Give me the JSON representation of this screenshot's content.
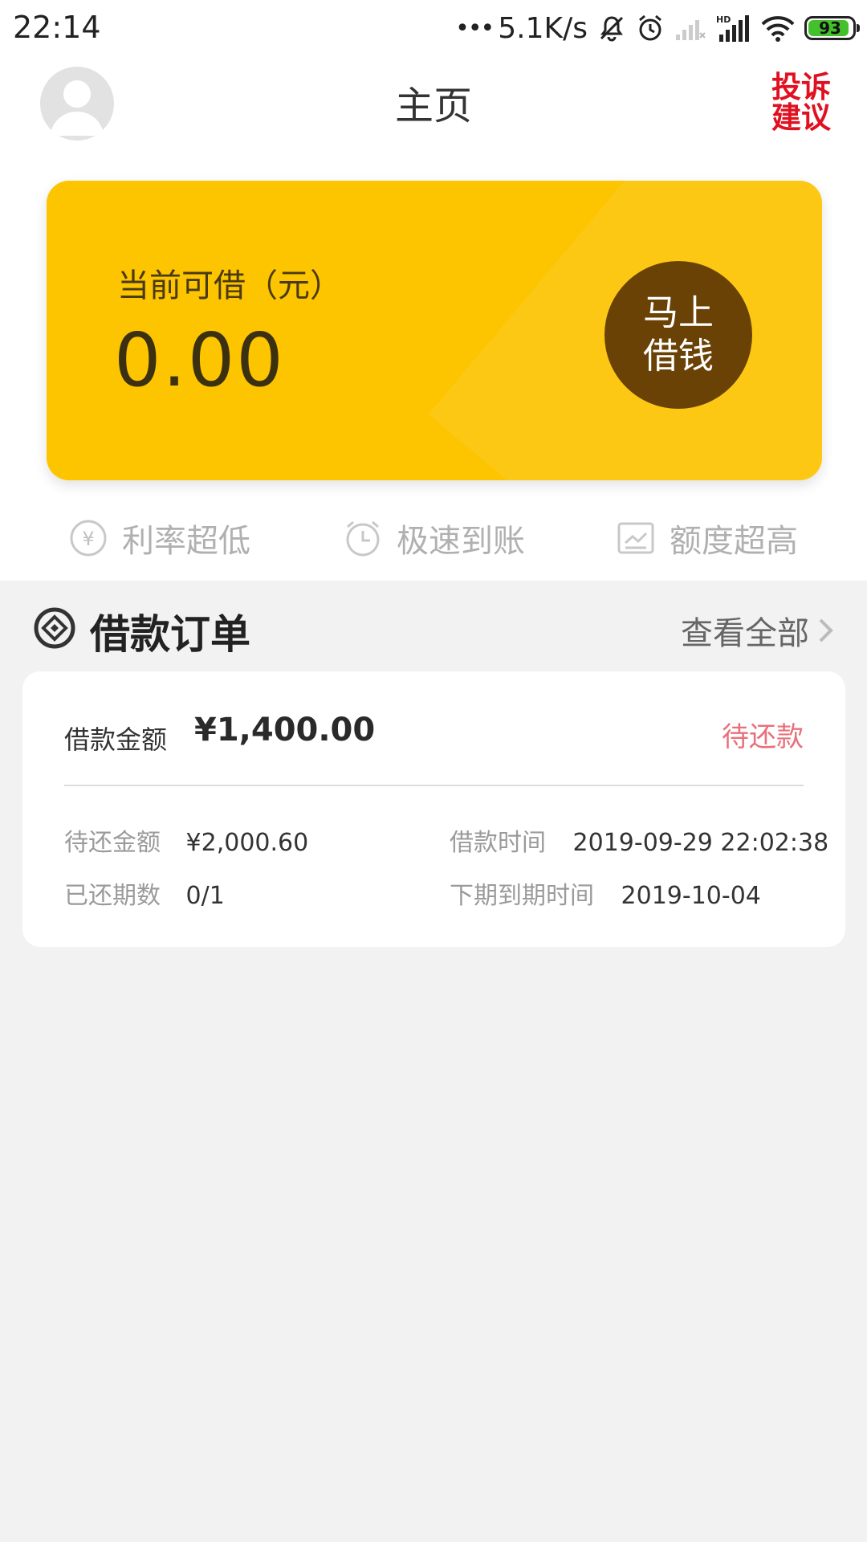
{
  "status_bar": {
    "time": "22:14",
    "dots": "•••",
    "net_speed": "5.1K/s",
    "hd": "HD",
    "battery_level": 93,
    "battery_label": "93",
    "battery_color": "#43c12c",
    "icons": [
      "mute-icon",
      "alarm-icon",
      "signal-icon",
      "signal-hd-icon",
      "wifi-icon",
      "battery-icon"
    ]
  },
  "header": {
    "title": "主页",
    "complaint_label": "投诉建议",
    "avatar_icon": "user-avatar-icon"
  },
  "credit_card": {
    "label": "当前可借（元）",
    "amount": "0.00",
    "button_label": "马上借钱",
    "bg_color": "#fdc400",
    "button_color": "#6b4206"
  },
  "features": [
    {
      "icon": "yen-icon",
      "label": "利率超低"
    },
    {
      "icon": "clock-icon",
      "label": "极速到账"
    },
    {
      "icon": "chart-icon",
      "label": "额度超高"
    }
  ],
  "orders_section": {
    "title": "借款订单",
    "view_all": "查看全部",
    "icon": "diamond-icon"
  },
  "order": {
    "amount_label": "借款金额",
    "amount": "¥1,400.00",
    "status": "待还款",
    "status_color": "#e8707a",
    "due_amount_label": "待还金额",
    "due_amount": "¥2,000.60",
    "loan_time_label": "借款时间",
    "loan_time": "2019-09-29 22:02:38",
    "paid_periods_label": "已还期数",
    "paid_periods": "0/1",
    "next_due_label": "下期到期时间",
    "next_due": "2019-10-04"
  }
}
